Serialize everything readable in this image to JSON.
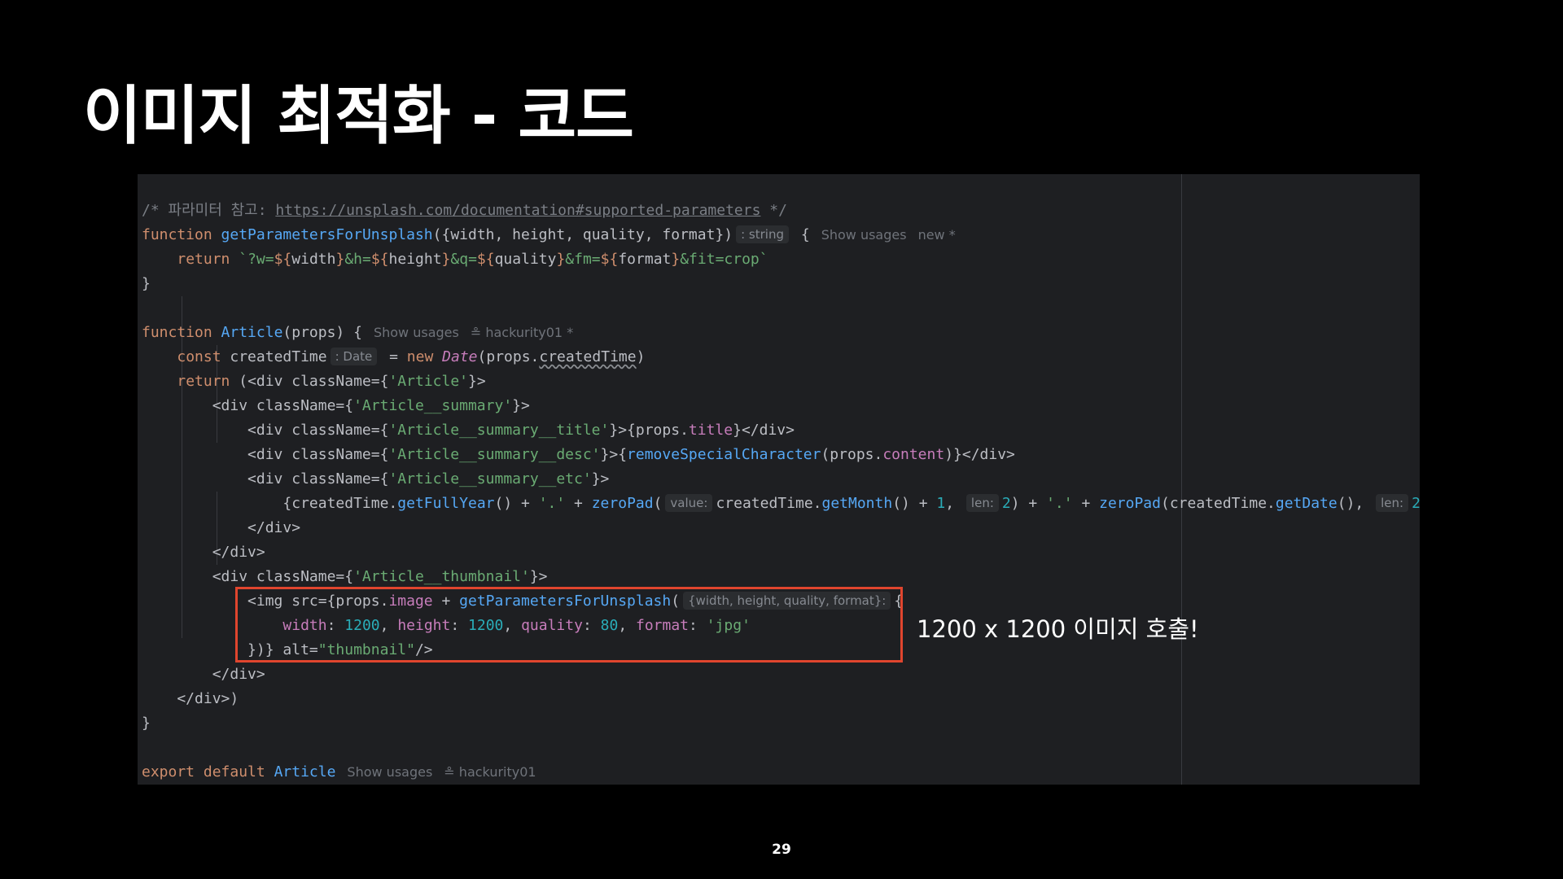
{
  "slide": {
    "title": "이미지 최적화 - 코드",
    "callout": "1200 x 1200 이미지 호출!",
    "page_number": "29"
  },
  "editor": {
    "comment_prefix": "/* 파라미터 참고: ",
    "comment_url": "https://unsplash.com/documentation#supported-parameters",
    "comment_suffix": " */",
    "hints": {
      "string_type": ": string",
      "date_type": ": Date",
      "value_param": "value:",
      "len_param": "len:",
      "object_param": "{width, height, quality, format}:"
    },
    "lens": {
      "show_usages": "Show usages",
      "new_marker": "new *",
      "author_modified": "hackurity01 *",
      "author": "hackurity01"
    }
  },
  "colors": {
    "background": "#000000",
    "editor_background": "#1e1f22",
    "keyword": "#cf8e6d",
    "function": "#56a8f5",
    "string": "#6aab73",
    "number": "#2aacb8",
    "property": "#c77dbb",
    "highlight_border": "#e0452e"
  }
}
